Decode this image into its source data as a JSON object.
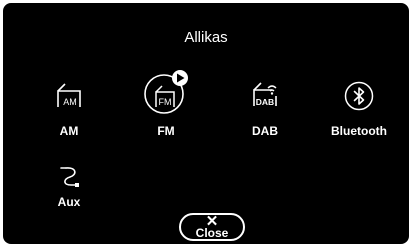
{
  "title": "Allikas",
  "sources": [
    {
      "label": "AM",
      "icon": "am-radio-icon",
      "icon_text": "AM"
    },
    {
      "label": "FM",
      "icon": "fm-radio-icon",
      "icon_text": "FM",
      "active": true
    },
    {
      "label": "DAB",
      "icon": "dab-radio-icon",
      "icon_text": "DAB"
    },
    {
      "label": "Bluetooth",
      "icon": "bluetooth-icon"
    },
    {
      "label": "Aux",
      "icon": "aux-cable-icon"
    }
  ],
  "close": {
    "label": "Close",
    "icon": "close-icon"
  },
  "colors": {
    "background": "#000000",
    "foreground": "#ffffff"
  }
}
